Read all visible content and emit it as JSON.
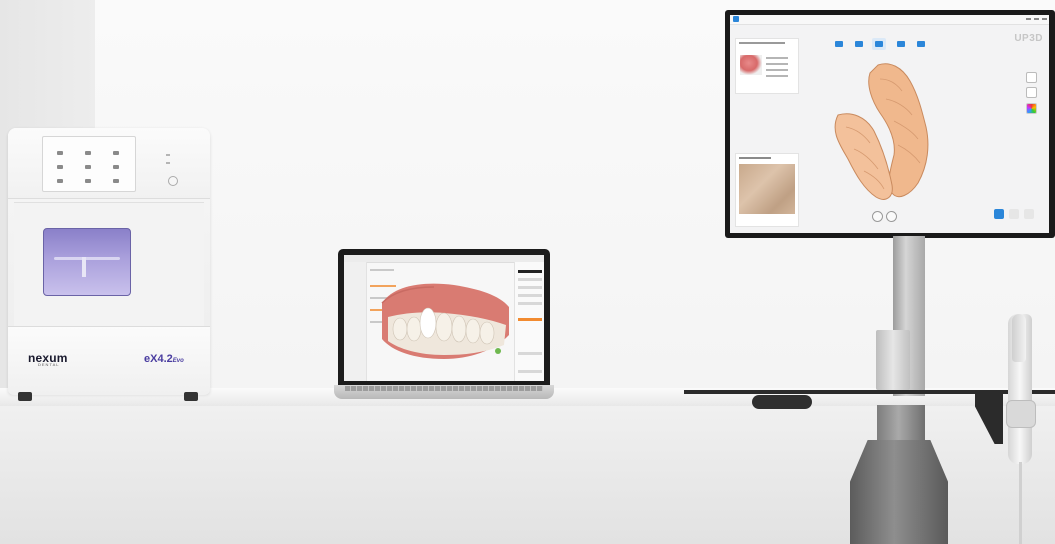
{
  "scene": {
    "description_free": true
  },
  "milling_machine": {
    "brand": "nexum",
    "brand_sub": "DENTAL",
    "model": "eX4.2",
    "model_suffix": "Evo",
    "window_color": "#9c92d6"
  },
  "laptop": {
    "screen_accent": "#f28b30"
  },
  "monitor": {
    "watermark": "UP3D",
    "accent": "#2b86d9"
  },
  "icons": [
    "power-button-icon",
    "toolbar-icon",
    "tooth-model",
    "camera-view",
    "rotate-icon",
    "view-icon"
  ]
}
